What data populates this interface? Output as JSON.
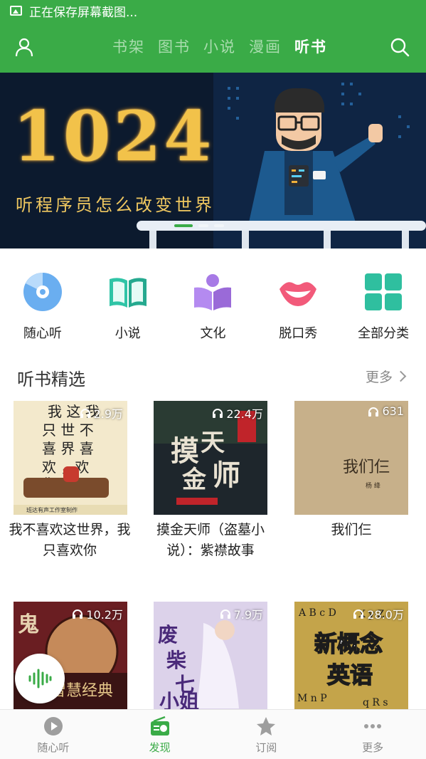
{
  "statusbar": {
    "text": "正在保存屏幕截图..."
  },
  "topnav": {
    "tabs": [
      {
        "label": "书架"
      },
      {
        "label": "图书"
      },
      {
        "label": "小说"
      },
      {
        "label": "漫画"
      },
      {
        "label": "听书",
        "active": true
      }
    ]
  },
  "banner": {
    "big_text": "1024",
    "sub_text": "听程序员怎么改变世界"
  },
  "categories": [
    {
      "label": "随心听",
      "icon": "disc-icon"
    },
    {
      "label": "小说",
      "icon": "open-book-icon"
    },
    {
      "label": "文化",
      "icon": "reading-person-icon"
    },
    {
      "label": "脱口秀",
      "icon": "lips-icon"
    },
    {
      "label": "全部分类",
      "icon": "grid-icon"
    }
  ],
  "section": {
    "title": "听书精选",
    "more": "更多"
  },
  "books": [
    {
      "title_lines": [
        "我不喜欢这世界，我",
        "只喜欢你"
      ],
      "plays": "2.9万",
      "cover_text": "我不喜欢这世界，我只喜欢你"
    },
    {
      "title_lines": [
        "摸金天师（盗墓小",
        "说）：紫襟故事"
      ],
      "plays": "22.4万",
      "cover_text": "摸金天师"
    },
    {
      "title_lines": [
        "我们仨"
      ],
      "plays": "631",
      "cover_text": "我们仨"
    },
    {
      "title_lines": [],
      "plays": "10.2万",
      "cover_text": "智慧经典"
    },
    {
      "title_lines": [],
      "plays": "7.9万",
      "cover_text": "废柴七小姐"
    },
    {
      "title_lines": [],
      "plays": "28.0万",
      "cover_text": "新概念英语"
    }
  ],
  "bottomnav": [
    {
      "label": "随心听",
      "icon": "play-circle-icon"
    },
    {
      "label": "发现",
      "icon": "radio-icon",
      "active": true
    },
    {
      "label": "订阅",
      "icon": "star-icon"
    },
    {
      "label": "更多",
      "icon": "more-dots-icon"
    }
  ],
  "colors": {
    "accent": "#3aab47",
    "banner_bg": "#0c1a2e",
    "banner_text": "#f2c24a"
  }
}
